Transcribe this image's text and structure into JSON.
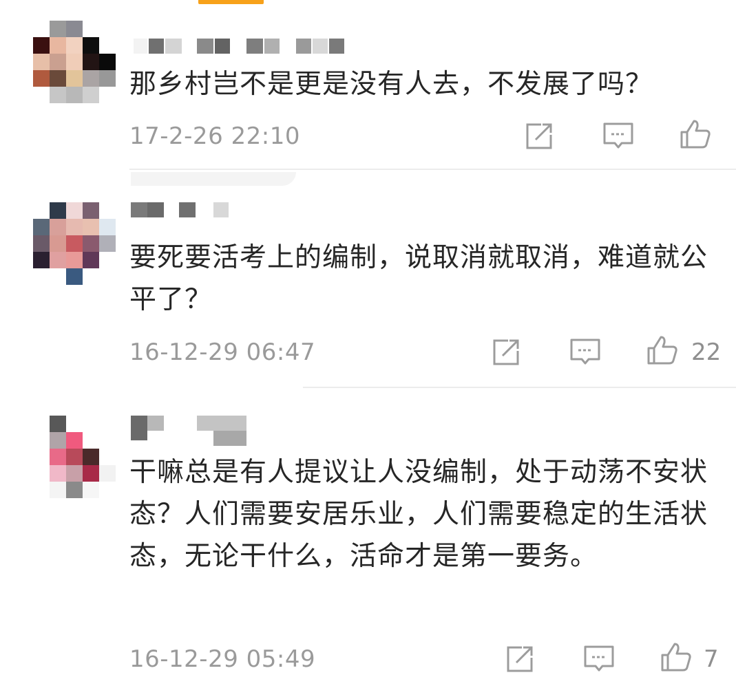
{
  "comments": [
    {
      "text": "那乡村岂不是更是没有人去，不发展了吗？",
      "time": "17-2-26 22:10",
      "likes": ""
    },
    {
      "text": "要死要活考上的编制，说取消就取消，难道就公平了？",
      "time": "16-12-29 06:47",
      "likes": "22"
    },
    {
      "text": "干嘛总是有人提议让人没编制，处于动荡不安状态？人们需要安居乐业，人们需要稳定的生活状态，无论干什么，活命才是第一要务。",
      "time": "16-12-29 05:49",
      "likes": "7"
    }
  ],
  "icons": {
    "share": "share-icon",
    "reply": "reply-icon",
    "like": "thumbs-up-icon"
  },
  "colors": {
    "accent": "#f7a11a",
    "text": "#262626",
    "meta": "#9a9a9a",
    "icon": "#9c9c9c",
    "divider": "#ececec"
  }
}
